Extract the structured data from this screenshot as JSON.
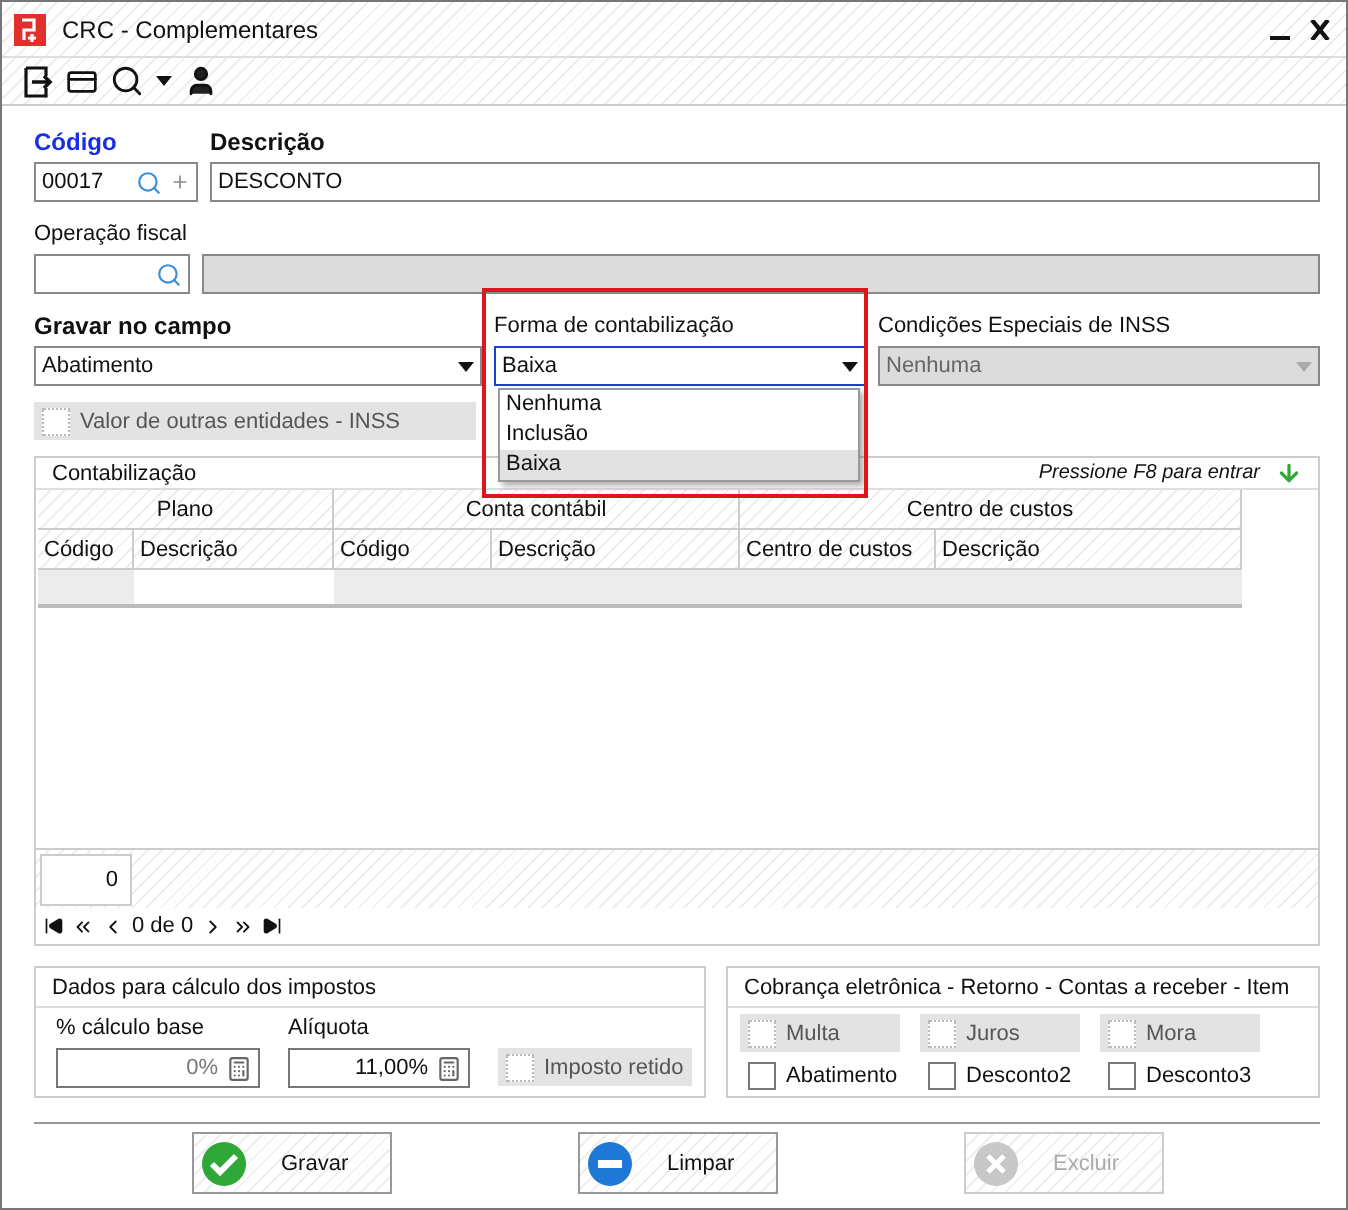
{
  "window": {
    "title": "CRC - Complementares"
  },
  "form": {
    "codigo": {
      "label": "Código",
      "value": "00017"
    },
    "descricao": {
      "label": "Descrição",
      "value": "DESCONTO"
    },
    "operacao_fiscal": {
      "label": "Operação fiscal",
      "description_disabled": true
    },
    "gravar_no_campo": {
      "label": "Gravar no campo",
      "value": "Abatimento"
    },
    "forma_de_contabilizacao": {
      "label": "Forma de contabilização",
      "value": "Baixa",
      "expanded": true,
      "options": [
        {
          "label": "Nenhuma",
          "selected": false
        },
        {
          "label": "Inclusão",
          "selected": false
        },
        {
          "label": "Baixa",
          "selected": true
        }
      ]
    },
    "condicoes_inss": {
      "label": "Condições Especiais de INSS",
      "value": "Nenhuma",
      "disabled": true
    },
    "outras_entidades": {
      "label": "Valor de outras entidades - INSS",
      "checked": false,
      "disabled": true
    }
  },
  "contabilizacao": {
    "title": "Contabilização",
    "hint": "Pressione F8 para entrar",
    "column_groups": [
      {
        "label": "Plano",
        "columns": [
          "Código",
          "Descrição"
        ]
      },
      {
        "label": "Conta contábil",
        "columns": [
          "Código",
          "Descrição"
        ]
      },
      {
        "label": "Centro de custos",
        "columns": [
          "Centro de custos",
          "Descrição"
        ]
      }
    ],
    "count": "0",
    "pager": "0 de 0"
  },
  "impostos": {
    "title": "Dados para cálculo dos impostos",
    "fields": [
      {
        "label": "% cálculo base",
        "value": "0%",
        "disabled": true
      },
      {
        "label": "Alíquota",
        "value": "11,00%",
        "disabled": false
      }
    ],
    "retido": {
      "label": "Imposto retido",
      "checked": false,
      "disabled": true
    }
  },
  "cobranca": {
    "title": "Cobrança eletrônica - Retorno - Contas a receber - Item",
    "options": [
      {
        "label": "Multa",
        "checked": false,
        "disabled": true
      },
      {
        "label": "Juros",
        "checked": false,
        "disabled": true
      },
      {
        "label": "Mora",
        "checked": false,
        "disabled": true
      },
      {
        "label": "Abatimento",
        "checked": false,
        "disabled": false
      },
      {
        "label": "Desconto2",
        "checked": false,
        "disabled": false
      },
      {
        "label": "Desconto3",
        "checked": false,
        "disabled": false
      }
    ]
  },
  "buttons": [
    {
      "label": "Gravar",
      "kind": "ok",
      "disabled": false
    },
    {
      "label": "Limpar",
      "kind": "clear",
      "disabled": false
    },
    {
      "label": "Excluir",
      "kind": "delete",
      "disabled": true
    }
  ]
}
